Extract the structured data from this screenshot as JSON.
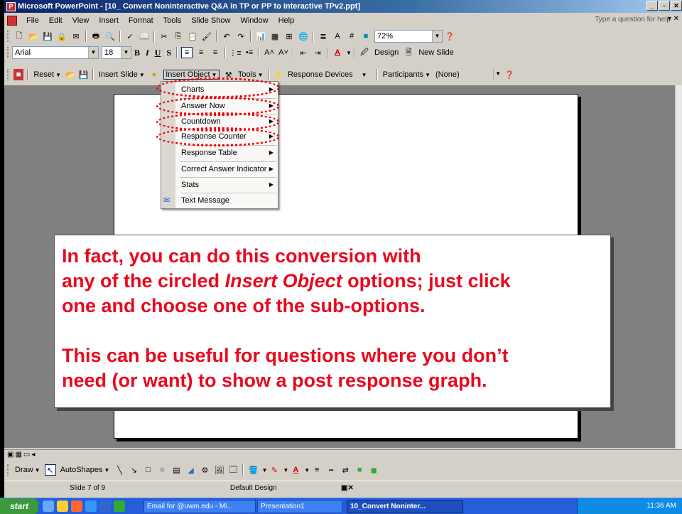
{
  "window": {
    "title": "Microsoft PowerPoint - [10_ Convert Noninteractive Q&A  in TP or PP to interactive TPv2.ppt]",
    "controls": [
      "_",
      "▫",
      "✕"
    ]
  },
  "menubar": {
    "items": [
      "File",
      "Edit",
      "View",
      "Insert",
      "Format",
      "Tools",
      "Slide Show",
      "Window",
      "Help"
    ],
    "help_placeholder": "Type a question for help"
  },
  "standard_toolbar": {
    "zoom": "72%"
  },
  "format_toolbar": {
    "font": "Arial",
    "size": "18",
    "design_label": "Design",
    "new_slide_label": "New Slide"
  },
  "tp_toolbar": {
    "reset_label": "Reset",
    "insert_slide_label": "Insert Slide",
    "insert_object_label": "Insert Object",
    "tools_label": "Tools",
    "response_devices_label": "Response Devices",
    "participants_label": "Participants",
    "participants_value": "(None)"
  },
  "insert_object_menu": {
    "items": [
      {
        "label": "Charts",
        "submenu": true
      },
      {
        "label": "Answer Now",
        "submenu": true
      },
      {
        "label": "Countdown",
        "submenu": true
      },
      {
        "label": "Response Counter",
        "submenu": true
      },
      {
        "label": "Response Table",
        "submenu": true
      },
      {
        "label": "Correct Answer Indicator",
        "submenu": true
      },
      {
        "label": "Stats",
        "submenu": true
      },
      {
        "label": "Text Message",
        "submenu": false
      }
    ]
  },
  "callout": {
    "line1": "In fact, you can do this conversion with",
    "line2a": "any of the circled ",
    "line2b": "Insert Object",
    "line2c": " options; just click",
    "line3": "one and choose one of the sub-options.",
    "line4": "This can be useful for questions where you don’t",
    "line5": "need (or want) to show a post response graph.",
    "color": "#e8091f"
  },
  "drawing_toolbar": {
    "draw_label": "Draw",
    "autoshapes_label": "AutoShapes"
  },
  "statusbar": {
    "slide_info": "Slide 7 of 9",
    "design": "Default Design"
  },
  "taskbar": {
    "start_label": "start",
    "tasks": [
      "Email for @uwm.edu - Mi...",
      "Presentation1",
      "10_Convert Noninter..."
    ],
    "clock": "11:36 AM"
  }
}
